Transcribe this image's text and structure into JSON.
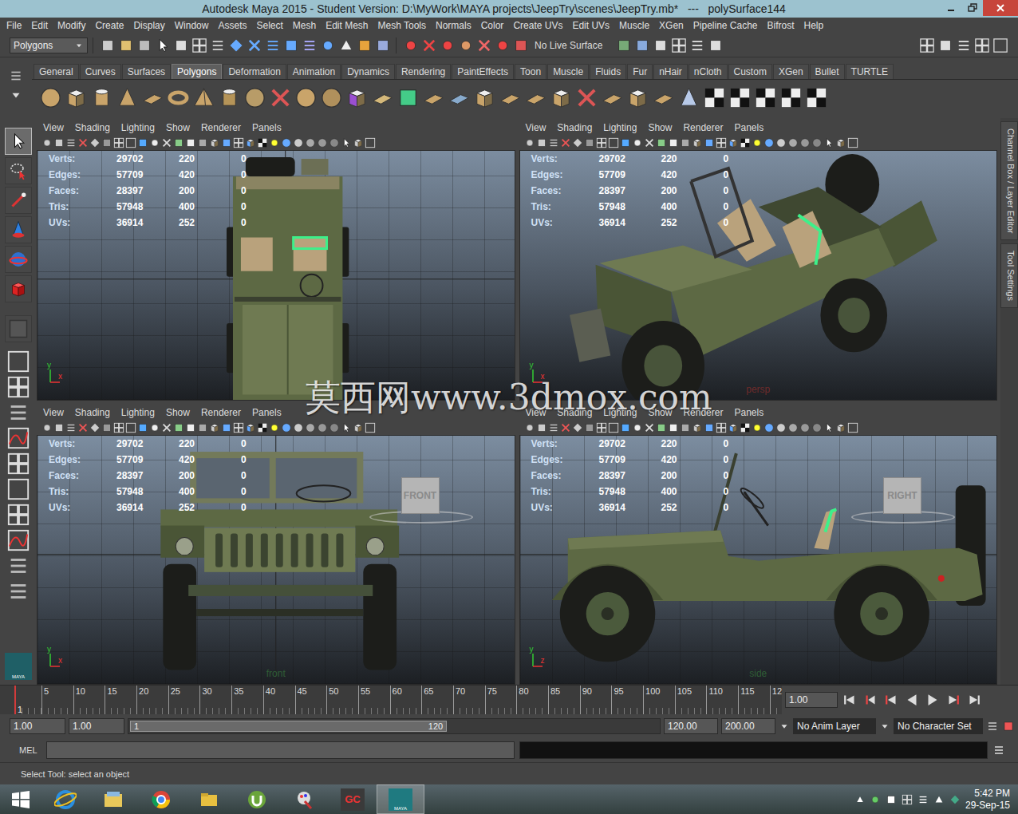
{
  "window": {
    "title": "Autodesk Maya 2015 - Student Version: D:\\MyWork\\MAYA projects\\JeepTry\\scenes\\JeepTry.mb*   ---   polySurface144"
  },
  "menu": [
    "File",
    "Edit",
    "Modify",
    "Create",
    "Display",
    "Window",
    "Assets",
    "Select",
    "Mesh",
    "Edit Mesh",
    "Mesh Tools",
    "Normals",
    "Color",
    "Create UVs",
    "Edit UVs",
    "Muscle",
    "XGen",
    "Pipeline Cache",
    "Bifrost",
    "Help"
  ],
  "status_line": {
    "menu_set": "Polygons",
    "live_surface": "No Live Surface"
  },
  "shelf": {
    "tabs": [
      {
        "label": "General",
        "selected": false
      },
      {
        "label": "Curves",
        "selected": false
      },
      {
        "label": "Surfaces",
        "selected": false
      },
      {
        "label": "Polygons",
        "selected": true
      },
      {
        "label": "Deformation",
        "selected": false
      },
      {
        "label": "Animation",
        "selected": false
      },
      {
        "label": "Dynamics",
        "selected": false
      },
      {
        "label": "Rendering",
        "selected": false
      },
      {
        "label": "PaintEffects",
        "selected": false
      },
      {
        "label": "Toon",
        "selected": false
      },
      {
        "label": "Muscle",
        "selected": false
      },
      {
        "label": "Fluids",
        "selected": false
      },
      {
        "label": "Fur",
        "selected": false
      },
      {
        "label": "nHair",
        "selected": false
      },
      {
        "label": "nCloth",
        "selected": false
      },
      {
        "label": "Custom",
        "selected": false
      },
      {
        "label": "XGen",
        "selected": false
      },
      {
        "label": "Bullet",
        "selected": false
      },
      {
        "label": "TURTLE",
        "selected": false
      }
    ]
  },
  "toolbox": {
    "tools": [
      {
        "tool": "select",
        "selected": true
      },
      {
        "tool": "lasso",
        "selected": false
      },
      {
        "tool": "paint",
        "selected": false
      },
      {
        "tool": "move",
        "selected": false
      },
      {
        "tool": "rotate",
        "selected": false
      },
      {
        "tool": "scale",
        "selected": false
      },
      {
        "tool": "last",
        "selected": false
      }
    ],
    "logo": "MAYA"
  },
  "viewport_menu": [
    "View",
    "Shading",
    "Lighting",
    "Show",
    "Renderer",
    "Panels"
  ],
  "hud": [
    {
      "label": "Verts:",
      "values": [
        "29702",
        "220",
        "0"
      ]
    },
    {
      "label": "Edges:",
      "values": [
        "57709",
        "420",
        "0"
      ]
    },
    {
      "label": "Faces:",
      "values": [
        "28397",
        "200",
        "0"
      ]
    },
    {
      "label": "Tris:",
      "values": [
        "57948",
        "400",
        "0"
      ]
    },
    {
      "label": "UVs:",
      "values": [
        "36914",
        "252",
        "0"
      ]
    }
  ],
  "viewports": [
    {
      "view": "top",
      "grid": true,
      "axes": [
        "y",
        "x"
      ]
    },
    {
      "view": "persp",
      "grid": false,
      "axes": [
        "y",
        "x"
      ],
      "camera_label": "persp",
      "color": "#6e2b2b"
    },
    {
      "view": "front",
      "grid": true,
      "axes": [
        "y",
        "x"
      ],
      "camera_label": "front",
      "color": "#2f5d36",
      "view_cube": "FRONT"
    },
    {
      "view": "side",
      "grid": true,
      "axes": [
        "y",
        "z"
      ],
      "camera_label": "side",
      "color": "#2f5d36",
      "view_cube": "RIGHT"
    }
  ],
  "watermark": "莫西网www.3dmox.com",
  "side_tabs": [
    "Channel Box / Layer Editor",
    "Tool Settings"
  ],
  "timeline": {
    "current": "1",
    "ticks": [
      "5",
      "10",
      "15",
      "20",
      "25",
      "30",
      "35",
      "40",
      "45",
      "50",
      "55",
      "60",
      "65",
      "70",
      "75",
      "80",
      "85",
      "90",
      "95",
      "100",
      "105",
      "110",
      "115",
      "12"
    ],
    "current_frame": "1.00"
  },
  "range": {
    "start": "1.00",
    "anim_start": "1.00",
    "slider_start": "1",
    "slider_end": "120",
    "anim_end": "120.00",
    "end": "200.00",
    "level": 0.6,
    "anim_layer": "No Anim Layer",
    "character_set": "No Character Set"
  },
  "command": {
    "language": "MEL"
  },
  "help_line": "Select Tool: select an object",
  "taskbar": {
    "apps": [
      {
        "app": "ie",
        "label": "",
        "active": false
      },
      {
        "app": "explorer",
        "label": "",
        "active": false
      },
      {
        "app": "chrome",
        "label": "",
        "active": false
      },
      {
        "app": "folder",
        "label": "",
        "active": false
      },
      {
        "app": "utorrent",
        "label": "",
        "active": false
      },
      {
        "app": "paint",
        "label": "",
        "active": false
      },
      {
        "app": "gc",
        "label": "GC",
        "active": false
      },
      {
        "app": "maya",
        "label": "MAYA",
        "active": true
      }
    ],
    "time": "5:42 PM",
    "date": "29-Sep-15"
  }
}
